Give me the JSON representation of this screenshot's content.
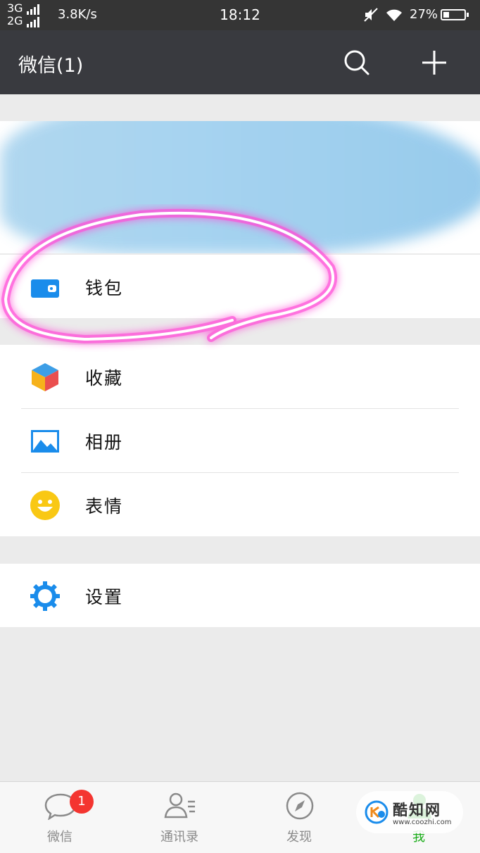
{
  "status_bar": {
    "network_top": "3G",
    "network_bottom": "2G",
    "speed": "3.8K/s",
    "time": "18:12",
    "battery_percent": "27%",
    "battery_level": 0.27
  },
  "header": {
    "title": "微信(1)",
    "icons": [
      "search-icon",
      "add-icon"
    ]
  },
  "menu": {
    "wallet": "钱包",
    "favorites": "收藏",
    "album": "相册",
    "stickers": "表情",
    "settings": "设置"
  },
  "tabs": [
    {
      "label": "微信",
      "badge": "1",
      "icon": "chat-icon"
    },
    {
      "label": "通讯录",
      "icon": "contacts-icon"
    },
    {
      "label": "发现",
      "icon": "compass-icon"
    },
    {
      "label": "我",
      "icon": "me-icon",
      "active": true
    }
  ],
  "watermark": {
    "name": "酷知网",
    "url": "www.coozhi.com"
  },
  "colors": {
    "header_bg": "#393a3f",
    "accent_green": "#1aad19",
    "badge_red": "#f43530",
    "annotation_pink": "#ff4fd8"
  }
}
